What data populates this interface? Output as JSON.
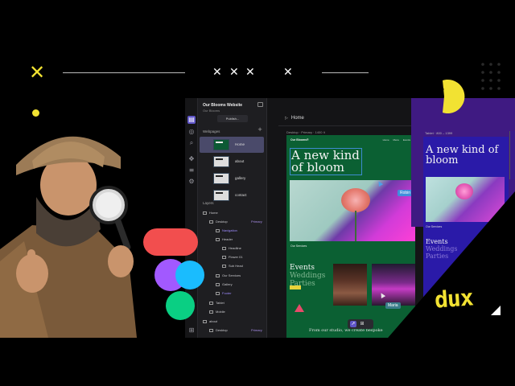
{
  "decor": {
    "x_marks": [
      "✕",
      "✕",
      "✕",
      "✕",
      "✕"
    ],
    "brand_logo": "dux"
  },
  "rail": {
    "icons": [
      "pages-icon",
      "cursor-icon",
      "search-icon",
      "move-icon",
      "database-icon",
      "settings-icon",
      "grid-icon"
    ]
  },
  "panel": {
    "site_title": "Our Blooms Website",
    "site_subtitle": "Our Blooms",
    "publish_label": "Publish...",
    "webpages_label": "Webpages",
    "pages": [
      {
        "name": "Home",
        "active": true
      },
      {
        "name": "about"
      },
      {
        "name": "gallery"
      },
      {
        "name": "contact"
      }
    ],
    "layers_label": "Layers",
    "layers": [
      {
        "name": "Home",
        "indent": 0
      },
      {
        "name": "Desktop",
        "indent": 1,
        "tag": "Primary"
      },
      {
        "name": "Navigation",
        "indent": 2,
        "violet": true
      },
      {
        "name": "Header",
        "indent": 2
      },
      {
        "name": "Headline",
        "indent": 3
      },
      {
        "name": "Flower 01",
        "indent": 3
      },
      {
        "name": "Sub Head",
        "indent": 3
      },
      {
        "name": "Our Services",
        "indent": 2
      },
      {
        "name": "Gallery",
        "indent": 2
      },
      {
        "name": "Footer",
        "indent": 2,
        "violet": true
      },
      {
        "name": "Tablet",
        "indent": 1
      },
      {
        "name": "Mobile",
        "indent": 1
      },
      {
        "name": "about",
        "indent": 0
      },
      {
        "name": "Desktop",
        "indent": 1,
        "tag": "Primary"
      }
    ]
  },
  "canvas": {
    "tab_label": "Home",
    "desktop_label": "Desktop · Primary · 1400 ∨",
    "tablet_label": "Tablet · 800 – 1399",
    "site": {
      "logo": "Our Blooms®",
      "nav": "Home  Menu  Events",
      "hero": "A new kind of bloom",
      "services": "Our Services",
      "events_line1": "Events",
      "events_line2": "Weddings",
      "events_line3": "Parties",
      "footer_text": "From our studio, we create bespoke"
    },
    "tablet": {
      "hero": "A new kind of bloom",
      "services": "Our Services",
      "events_line1": "Events",
      "events_line2": "Weddings",
      "events_line3": "Parties"
    },
    "cursors": [
      {
        "name": "Robin",
        "color": "#3f8fdc"
      },
      {
        "name": "Maria",
        "color": "#3a7d8a"
      }
    ]
  },
  "colors": {
    "accent": "#5f55c8",
    "site_green": "#0b6033",
    "tablet_blue": "#2a1aa8",
    "brand_yellow": "#f2e232"
  }
}
